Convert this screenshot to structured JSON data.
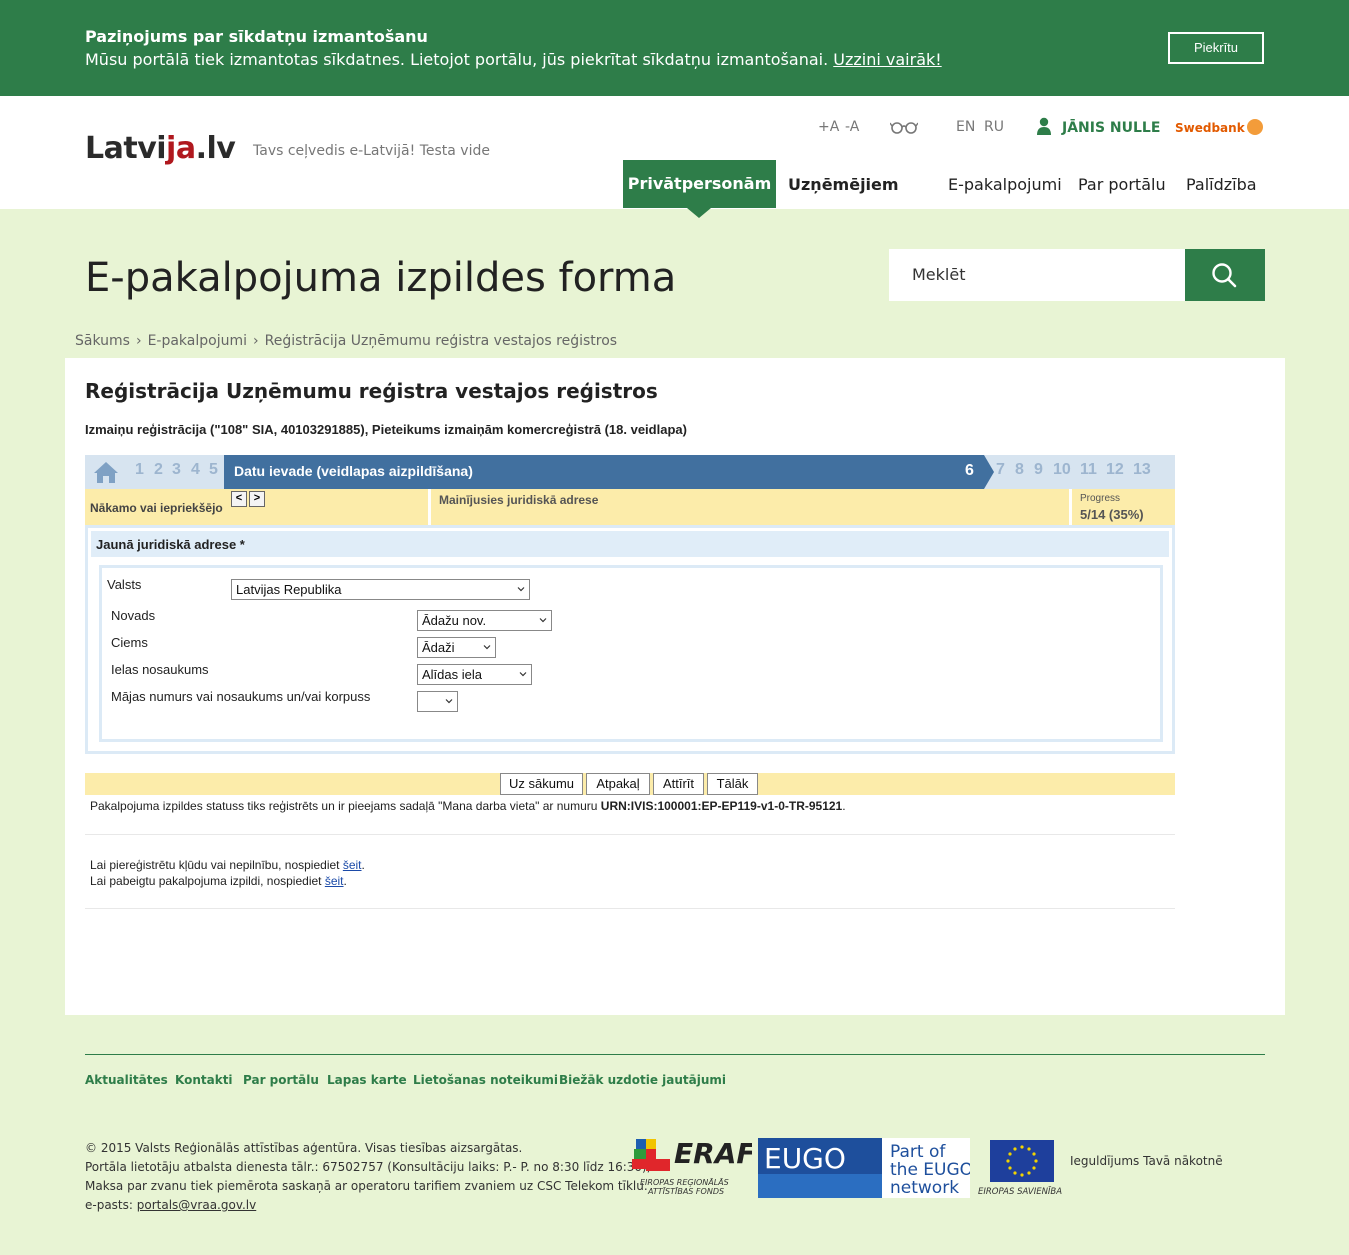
{
  "cookie": {
    "title": "Paziņojums par sīkdatņu izmantošanu",
    "text": "Mūsu portālā tiek izmantotas sīkdatnes. Lietojot portālu, jūs piekrītat sīkdatņu izmantošanai.",
    "link": "Uzzini vairāk!",
    "accept": "Piekrītu"
  },
  "header": {
    "logo_a": "Latvi",
    "logo_b": "ja",
    "logo_c": ".lv",
    "tagline": "Tavs ceļvedis e-Latvijā! Testa vide",
    "font_plus": "+A",
    "font_minus": "-A",
    "lang_en": "EN",
    "lang_ru": "RU",
    "user": "JĀNIS NULLE",
    "bank": "Swedbank",
    "nav": {
      "private": "Privātpersonām",
      "business": "Uzņēmējiem",
      "eservices": "E-pakalpojumi",
      "about": "Par portālu",
      "help": "Palīdzība"
    }
  },
  "page": {
    "title": "E-pakalpojuma izpildes forma",
    "search_placeholder": "Meklēt",
    "breadcrumb": [
      "Sākums",
      "E-pakalpojumi",
      "Reģistrācija Uzņēmumu reģistra vestajos reģistros"
    ]
  },
  "form": {
    "heading": "Reģistrācija Uzņēmumu reģistra vestajos reģistros",
    "subheading": "Izmaiņu reģistrācija (\"108\" SIA, 40103291885), Pieteikums izmaiņām komercreģistrā (18. veidlapa)",
    "steps_before": [
      "1",
      "2",
      "3",
      "4",
      "5"
    ],
    "active_step_label": "Datu ievade (veidlapas aizpildīšana)",
    "active_step_num": "6",
    "steps_after": [
      "7",
      "8",
      "9",
      "10",
      "11",
      "12",
      "13"
    ],
    "nav_label": "Nākamo vai iepriekšējo",
    "prev": "<",
    "next": ">",
    "section_changed": "Mainījusies juridiskā adrese",
    "progress_label": "Progress",
    "progress_value": "5/14 (35%)",
    "box_title": "Jaunā juridiskā adrese *",
    "fields": {
      "country_label": "Valsts",
      "country_value": "Latvijas Republika",
      "county_label": "Novads",
      "county_value": "Ādažu nov.",
      "village_label": "Ciems",
      "village_value": "Ādaži",
      "street_label": "Ielas nosaukums",
      "street_value": "Alīdas iela",
      "house_label": "Mājas numurs vai nosaukums un/vai korpuss",
      "house_value": ""
    },
    "buttons": {
      "start": "Uz sākumu",
      "back": "Atpakaļ",
      "reset": "Attīrīt",
      "next": "Tālāk"
    },
    "status_prefix": "Pakalpojuma izpildes statuss tiks reģistrēts un ir pieejams sadaļā \"Mana darba vieta\" ar numuru",
    "status_code": "URN:IVIS:100001:EP-EP119-v1-0-TR-95121",
    "note1_prefix": "Lai piereģistrētu kļūdu vai nepilnību, nospiediet",
    "note2_prefix": "Lai pabeigtu pakalpojuma izpildi, nospiediet",
    "here": "šeit"
  },
  "footer": {
    "links": [
      "Aktualitātes",
      "Kontakti",
      "Par portālu",
      "Lapas karte",
      "Lietošanas noteikumi",
      "Biežāk uzdotie jautājumi"
    ],
    "copy1": "© 2015 Valsts Reģionālās attīstības aģentūra. Visas tiesības aizsargātas.",
    "copy2": "Portāla lietotāju atbalsta dienesta tālr.: 67502757 (Konsultāciju laiks: P.- P. no 8:30 līdz 16:30),",
    "copy3": "Maksa par zvanu tiek piemērota saskaņā ar operatoru tarifiem zvaniem uz CSC Telekom tīklu.",
    "email_prefix": "e-pasts:",
    "email": "portals@vraa.gov.lv",
    "eraf": "ERAF",
    "eraf_sub1": "EIROPAS REĢIONĀLĀS",
    "eraf_sub2": "ATTĪSTĪBAS FONDS",
    "eugo": "EUGO",
    "eugo_part1": "Part of",
    "eugo_part2": "the EUGO",
    "eugo_part3": "network",
    "eu": "EIROPAS SAVIENĪBA",
    "invest": "Ieguldījums Tavā nākotnē"
  },
  "colors": {
    "brand_green": "#2e7d49",
    "step_blue": "#41709f",
    "info_yellow": "#fcecaa",
    "page_bg": "#e8f4d4"
  }
}
